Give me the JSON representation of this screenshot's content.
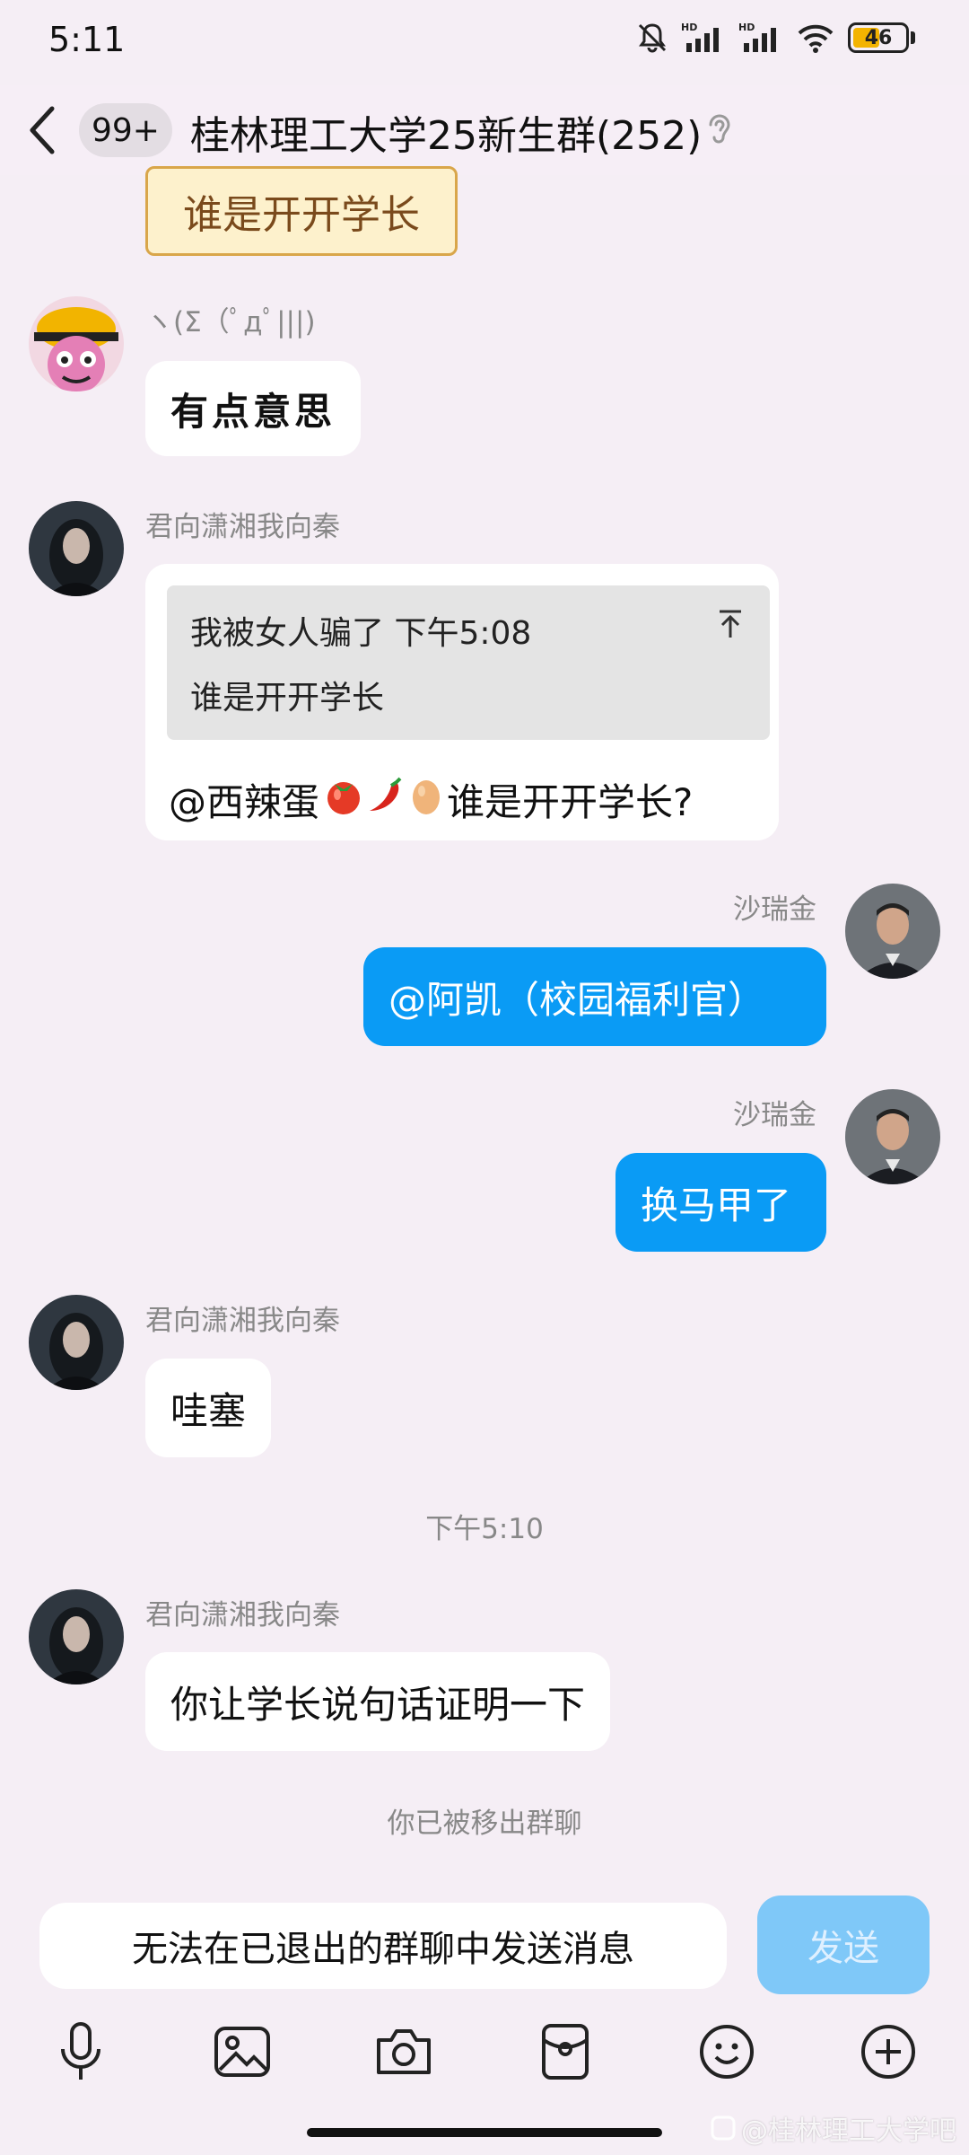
{
  "status_bar": {
    "time": "5:11",
    "battery": "46",
    "icons": [
      "mute-bell-icon",
      "hd-signal-icon",
      "hd-signal-icon",
      "wifi-icon",
      "battery-icon"
    ]
  },
  "header": {
    "back_icon": "chevron-left-icon",
    "unread_badge": "99+",
    "title": "桂林理工大学25新生群(252)",
    "ear_icon": "ear-icon"
  },
  "messages": {
    "sticker_text": "谁是开开学长",
    "m1": {
      "sender": "ヽ(Σ（ﾟдﾟ|||)",
      "text": "有点意思"
    },
    "m2": {
      "sender": "君向潇湘我向秦",
      "quote_head": "我被女人骗了 下午5:08",
      "quote_body": "谁是开开学长",
      "reply_prefix": "@西辣蛋",
      "reply_emoji": [
        "tomato-emoji",
        "chili-emoji",
        "egg-emoji"
      ],
      "reply_suffix": " 谁是开开学长?"
    },
    "m3": {
      "sender": "沙瑞金",
      "text": "@阿凯（校园福利官）"
    },
    "m4": {
      "sender": "沙瑞金",
      "text": "换马甲了"
    },
    "m5": {
      "sender": "君向潇湘我向秦",
      "text": "哇塞"
    },
    "time_divider": "下午5:10",
    "m6": {
      "sender": "君向潇湘我向秦",
      "text": "你让学长说句话证明一下"
    },
    "system_notice": "你已被移出群聊"
  },
  "input": {
    "placeholder": "无法在已退出的群聊中发送消息",
    "send_label": "发送"
  },
  "toolbar": {
    "icons": [
      "microphone-icon",
      "image-icon",
      "camera-icon",
      "red-packet-icon",
      "emoji-icon",
      "plus-icon"
    ]
  },
  "watermark": "@桂林理工大学吧",
  "colors": {
    "background": "#f5eef5",
    "my_bubble": "#0a9bf5",
    "send_button_disabled": "#7fc8f8"
  }
}
